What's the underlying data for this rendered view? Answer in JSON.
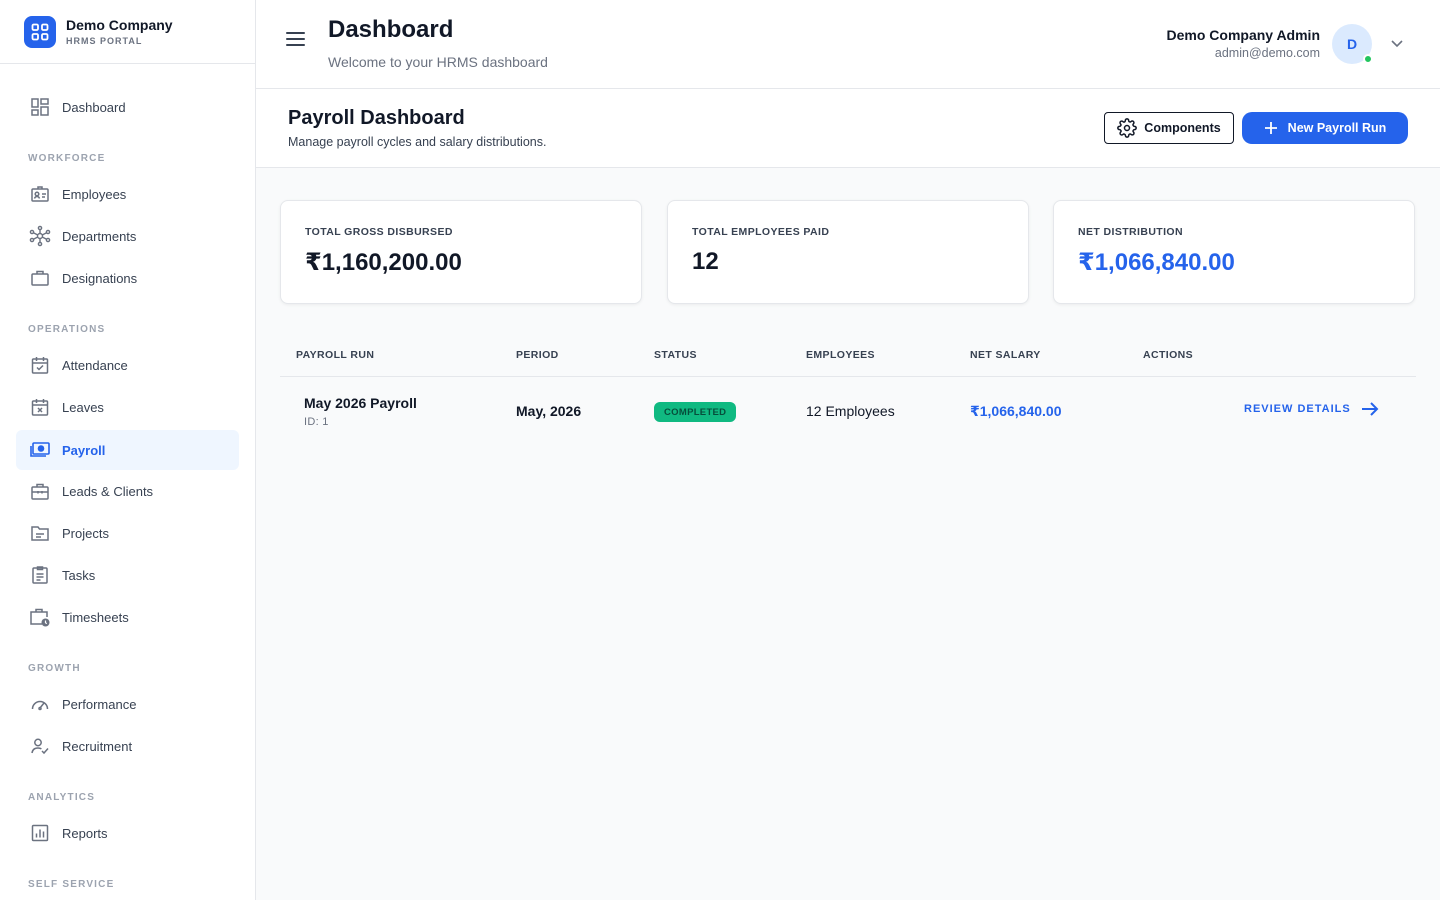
{
  "brand": {
    "name": "Demo Company",
    "subtitle": "HRMS PORTAL",
    "icon": "grid-logo-icon"
  },
  "sidebar": {
    "sections": {
      "workforce": "WORKFORCE",
      "operations": "OPERATIONS",
      "growth": "GROWTH",
      "analytics": "ANALYTICS",
      "self_service": "SELF SERVICE"
    },
    "items": {
      "dashboard": "Dashboard",
      "employees": "Employees",
      "departments": "Departments",
      "designations": "Designations",
      "attendance": "Attendance",
      "leaves": "Leaves",
      "payroll": "Payroll",
      "leads": "Leads & Clients",
      "projects": "Projects",
      "tasks": "Tasks",
      "timesheets": "Timesheets",
      "performance": "Performance",
      "recruitment": "Recruitment",
      "reports": "Reports"
    },
    "active": "payroll"
  },
  "header": {
    "title": "Dashboard",
    "subtitle": "Welcome to your HRMS dashboard",
    "user_name": "Demo Company Admin",
    "user_email": "admin@demo.com",
    "avatar_initial": "D"
  },
  "subheader": {
    "title": "Payroll Dashboard",
    "description": "Manage payroll cycles and salary distributions.",
    "components_label": "Components",
    "new_run_label": "New Payroll Run"
  },
  "stats": {
    "gross_label": "TOTAL GROSS DISBURSED",
    "gross_value": "₹1,160,200.00",
    "employees_label": "TOTAL EMPLOYEES PAID",
    "employees_value": "12",
    "net_label": "NET DISTRIBUTION",
    "net_value": "₹1,066,840.00"
  },
  "table": {
    "columns": {
      "run": "PAYROLL RUN",
      "period": "PERIOD",
      "status": "STATUS",
      "employees": "EMPLOYEES",
      "net": "NET SALARY",
      "actions": "ACTIONS"
    },
    "rows": [
      {
        "name": "May 2026 Payroll",
        "id": "ID: 1",
        "period": "May, 2026",
        "status": "COMPLETED",
        "employees": "12 Employees",
        "net": "₹1,066,840.00",
        "action": "REVIEW DETAILS"
      }
    ]
  },
  "colors": {
    "accent": "#2563eb",
    "success": "#10b981",
    "border": "#e5e7eb"
  }
}
